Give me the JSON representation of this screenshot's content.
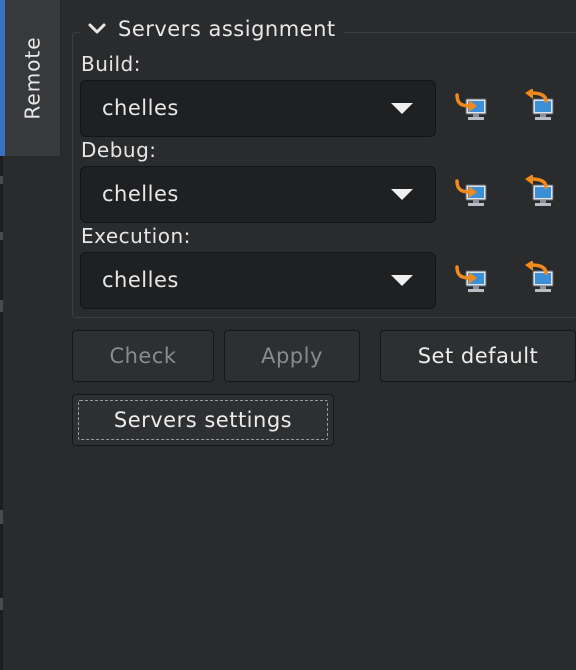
{
  "side_tab": {
    "label": "Remote"
  },
  "group": {
    "title": "Servers assignment"
  },
  "fields": [
    {
      "label": "Build:",
      "value": "chelles"
    },
    {
      "label": "Debug:",
      "value": "chelles"
    },
    {
      "label": "Execution:",
      "value": "chelles"
    }
  ],
  "buttons": {
    "check": "Check",
    "apply": "Apply",
    "set_default": "Set default",
    "servers_settings": "Servers settings"
  },
  "icons": {
    "upload": "server-upload-icon",
    "download": "server-download-icon"
  },
  "colors": {
    "background": "#2a2b2d",
    "accent": "#3d6fc0",
    "icon_orange": "#f08a1c",
    "icon_monitor": "#3a8fd6"
  }
}
